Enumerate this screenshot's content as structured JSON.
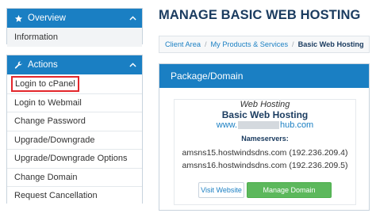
{
  "sidebar": {
    "overview": {
      "title": "Overview",
      "items": [
        "Information"
      ]
    },
    "actions": {
      "title": "Actions",
      "items": [
        "Login to cPanel",
        "Login to Webmail",
        "Change Password",
        "Upgrade/Downgrade",
        "Upgrade/Downgrade Options",
        "Change Domain",
        "Request Cancellation"
      ]
    }
  },
  "main": {
    "page_title": "MANAGE BASIC WEB HOSTING",
    "breadcrumb": [
      "Client Area",
      "My Products & Services",
      "Basic Web Hosting"
    ],
    "package": {
      "header": "Package/Domain",
      "type": "Web Hosting",
      "name": "Basic Web Hosting",
      "domain_prefix": "www.",
      "domain_suffix": "hub.com",
      "nameservers_label": "Nameservers:",
      "nameservers": [
        "amsns15.hostwindsdns.com (192.236.209.4)",
        "amsns16.hostwindsdns.com (192.236.209.5)"
      ],
      "visit_button": "Visit Website",
      "manage_button": "Manage Domain"
    }
  },
  "colors": {
    "accent": "#1a7fc3",
    "title": "#1b3c60",
    "highlight": "#e3262b",
    "success": "#5cb85c"
  },
  "icons": {
    "overview": "star-icon",
    "actions": "wrench-icon",
    "collapse": "chevron-up-icon"
  }
}
